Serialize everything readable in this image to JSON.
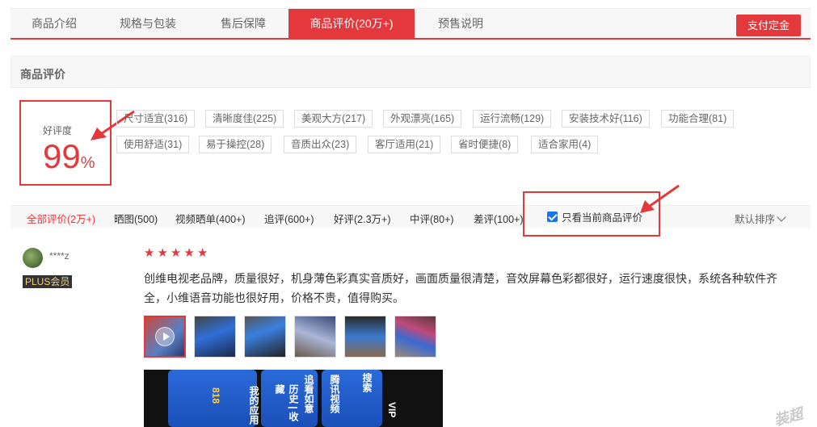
{
  "tabs": [
    {
      "label": "商品介绍",
      "active": false
    },
    {
      "label": "规格与包装",
      "active": false
    },
    {
      "label": "售后保障",
      "active": false
    },
    {
      "label": "商品评价(20万+)",
      "active": true
    },
    {
      "label": "预售说明",
      "active": false
    }
  ],
  "pay_button": "支付定金",
  "section_title": "商品评价",
  "score": {
    "label": "好评度",
    "value": "99",
    "unit": "%"
  },
  "tags": [
    "尺寸适宜(316)",
    "清晰度佳(225)",
    "美观大方(217)",
    "外观漂亮(165)",
    "运行流畅(129)",
    "安装技术好(116)",
    "功能合理(81)",
    "使用舒适(31)",
    "易于操控(28)",
    "音质出众(23)",
    "客厅适用(21)",
    "省时便捷(8)",
    "适合家用(4)"
  ],
  "filters": [
    {
      "label": "全部评价(2万+)",
      "active": true
    },
    {
      "label": "晒图(500)",
      "active": false
    },
    {
      "label": "视频晒单(400+)",
      "active": false
    },
    {
      "label": "追评(600+)",
      "active": false
    },
    {
      "label": "好评(2.3万+)",
      "active": false
    },
    {
      "label": "中评(80+)",
      "active": false
    },
    {
      "label": "差评(100+)",
      "active": false
    }
  ],
  "only_current": {
    "label": "只看当前商品评价",
    "checked": true
  },
  "sort_label": "默认排序",
  "review": {
    "user": "****z",
    "badge": "PLUS会员",
    "rating": 5,
    "text": "创维电视老品牌，质量很好，机身薄色彩真实音质好，画面质量很清楚，音效屏幕色彩都很好，运行速度很快，系统各种软件齐全，小维语音功能也很好用，价格不贵，值得购买。",
    "thumb_count": 6,
    "photo_texts": [
      "腾讯视频",
      "搜索",
      "VIP",
      "追看如意",
      "历史 | 收藏",
      "我的应用",
      "818"
    ]
  },
  "watermark": "装超值",
  "colors": {
    "accent": "#e4393c",
    "checkbox": "#1a73e8",
    "tab_bg": "#f7f7f7"
  }
}
